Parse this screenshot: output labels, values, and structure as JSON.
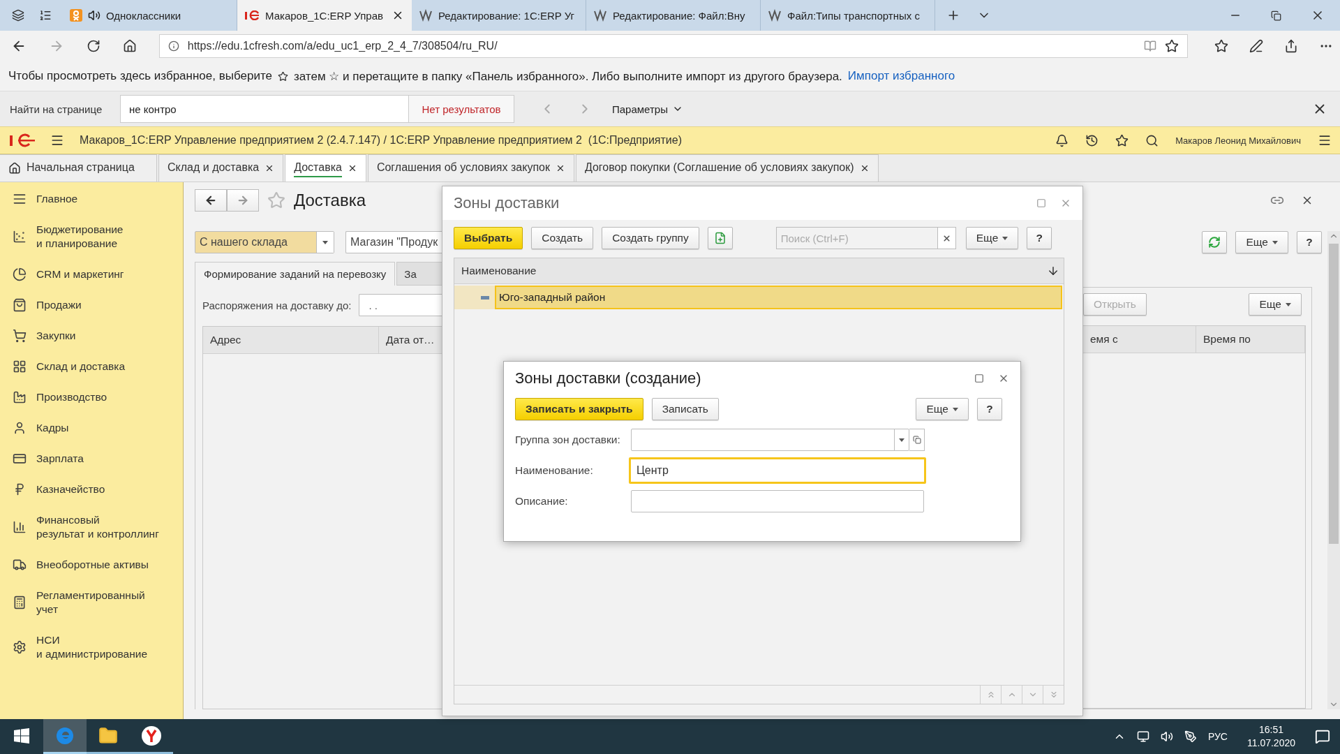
{
  "browser": {
    "tabs": [
      {
        "label": "Одноклассники",
        "selected": false,
        "playing_audio": true
      },
      {
        "label": "Макаров_1С:ERP Управ",
        "selected": true,
        "playing_audio": false
      },
      {
        "label": "Редактирование: 1С:ERP Уг",
        "selected": false,
        "playing_audio": false
      },
      {
        "label": "Редактирование: Файл:Вну",
        "selected": false,
        "playing_audio": false
      },
      {
        "label": "Файл:Типы транспортных с",
        "selected": false,
        "playing_audio": false
      }
    ],
    "url": "https://edu.1cfresh.com/a/edu_uc1_erp_2_4_7/308504/ru_RU/",
    "favorites_bar": {
      "text_before": "Чтобы просмотреть здесь избранное, выберите",
      "text_after": "затем ☆ и перетащите в папку «Панель избранного». Либо выполните импорт из другого браузера.",
      "link": "Импорт избранного"
    },
    "find_bar": {
      "label": "Найти на странице",
      "value": "не контро",
      "status": "Нет результатов",
      "options": "Параметры"
    }
  },
  "app": {
    "title": "Макаров_1С:ERP Управление предприятием 2 (2.4.7.147) / 1С:ERP Управление предприятием 2  (1С:Предприятие)",
    "user": "Макаров Леонид Михайлович",
    "tabs": [
      {
        "label": "Начальная страница",
        "selected": false,
        "closable": false
      },
      {
        "label": "Склад и доставка",
        "selected": false,
        "closable": true
      },
      {
        "label": "Доставка",
        "selected": true,
        "closable": true
      },
      {
        "label": "Соглашения об условиях закупок",
        "selected": false,
        "closable": true
      },
      {
        "label": "Договор покупки (Соглашение об условиях закупок)",
        "selected": false,
        "closable": true
      }
    ]
  },
  "sidebar": {
    "items": [
      {
        "lines": [
          "Главное"
        ]
      },
      {
        "lines": [
          "Бюджетирование",
          "и планирование"
        ]
      },
      {
        "lines": [
          "CRM и маркетинг"
        ]
      },
      {
        "lines": [
          "Продажи"
        ]
      },
      {
        "lines": [
          "Закупки"
        ]
      },
      {
        "lines": [
          "Склад и доставка"
        ]
      },
      {
        "lines": [
          "Производство"
        ]
      },
      {
        "lines": [
          "Кадры"
        ]
      },
      {
        "lines": [
          "Зарплата"
        ]
      },
      {
        "lines": [
          "Казначейство"
        ]
      },
      {
        "lines": [
          "Финансовый",
          "результат и контроллинг"
        ]
      },
      {
        "lines": [
          "Внеоборотные активы"
        ]
      },
      {
        "lines": [
          "Регламентированный",
          "учет"
        ]
      },
      {
        "lines": [
          "НСИ",
          "и администрирование"
        ]
      }
    ]
  },
  "form": {
    "title": "Доставка",
    "delivery_type": "С нашего склада",
    "store": "Магазин \"Продук",
    "tabs": [
      {
        "label": "Формирование заданий на перевозку",
        "selected": true
      },
      {
        "label": "За",
        "selected": false
      }
    ],
    "date_filter": {
      "label": "Распоряжения на доставку до:",
      "value": ". ."
    },
    "toolbar": {
      "more": "Еще",
      "help": "?"
    },
    "table_toolbar": {
      "open": {
        "label": "Открыть",
        "disabled": true
      },
      "more": "Еще"
    },
    "table": {
      "columns": [
        "Адрес",
        "Дата от…",
        "емя с",
        "Время по"
      ]
    }
  },
  "zones_dialog": {
    "title": "Зоны доставки",
    "buttons": {
      "select": "Выбрать",
      "create": "Создать",
      "create_group": "Создать группу",
      "more": "Еще",
      "help": "?"
    },
    "search": {
      "placeholder": "Поиск (Ctrl+F)"
    },
    "column": "Наименование",
    "rows": [
      {
        "name": "Юго-западный район",
        "selected": true
      }
    ]
  },
  "create_dialog": {
    "title": "Зоны доставки (создание)",
    "buttons": {
      "save_close": "Записать и закрыть",
      "save": "Записать",
      "more": "Еще",
      "help": "?"
    },
    "fields": [
      {
        "label": "Группа зон доставки:",
        "kind": "select",
        "focused": false
      },
      {
        "label": "Наименование:",
        "kind": "text",
        "value": "Центр",
        "focused": true
      },
      {
        "label": "Описание:",
        "kind": "text",
        "focused": false
      }
    ]
  },
  "taskbar": {
    "apps": [
      {
        "kind": "browser",
        "selected": true
      },
      {
        "kind": "folder",
        "selected": false
      },
      {
        "kind": "round",
        "selected": false
      }
    ],
    "language": "РУС",
    "time": "16:51",
    "date": "11.07.2020"
  }
}
